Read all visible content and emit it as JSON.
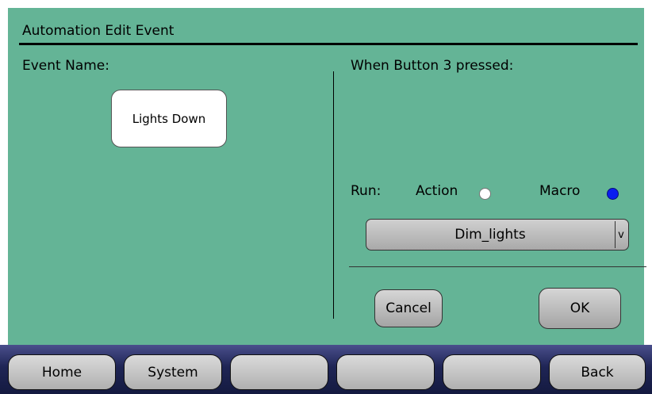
{
  "header": {
    "title": "Automation Edit Event"
  },
  "event": {
    "name_label": "Event Name:",
    "name_value": "Lights Down"
  },
  "trigger": {
    "label": "When Button 3 pressed:",
    "run_label": "Run:",
    "options": [
      {
        "label": "Action",
        "selected": false
      },
      {
        "label": "Macro",
        "selected": true
      }
    ],
    "dropdown_value": "Dim_lights",
    "dropdown_arrow": "v"
  },
  "dialog": {
    "cancel_label": "Cancel",
    "ok_label": "OK"
  },
  "nav": {
    "buttons": [
      "Home",
      "System",
      "",
      "",
      "",
      "Back"
    ]
  },
  "colors": {
    "panel_bg": "#64b496",
    "selected_radio": "#0a1cf0",
    "nav_bg": "#1f2555"
  }
}
